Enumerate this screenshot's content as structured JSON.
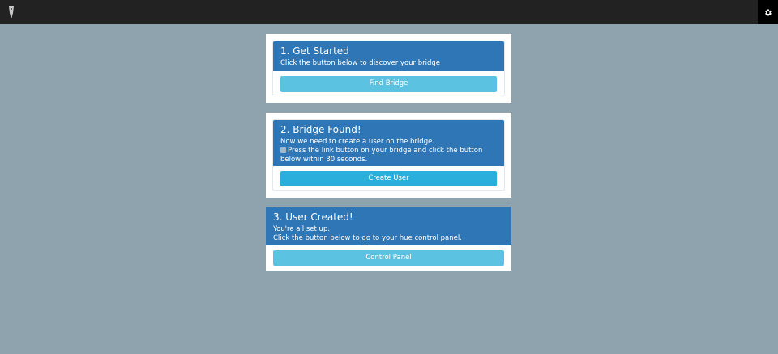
{
  "topbar": {
    "logo_icon": "remote-icon",
    "settings_icon": "gear-icon"
  },
  "steps": [
    {
      "title": "1. Get Started",
      "lines": [
        "Click the button below to discover your bridge"
      ],
      "button": "Find Bridge"
    },
    {
      "title": "2. Bridge Found!",
      "lines": [
        "Now we need to create a user on the bridge.",
        "Press the link button on your bridge and click the button",
        "below within 30 seconds."
      ],
      "button": "Create User"
    },
    {
      "title": "3. User Created!",
      "lines": [
        "You're all set up.",
        "Click the button below to go to your hue control panel."
      ],
      "button": "Control Panel"
    }
  ],
  "colors": {
    "background": "#8fa3ae",
    "header": "#2e76b6",
    "button_light": "#5bc2e2",
    "button_active": "#2aaedb"
  }
}
